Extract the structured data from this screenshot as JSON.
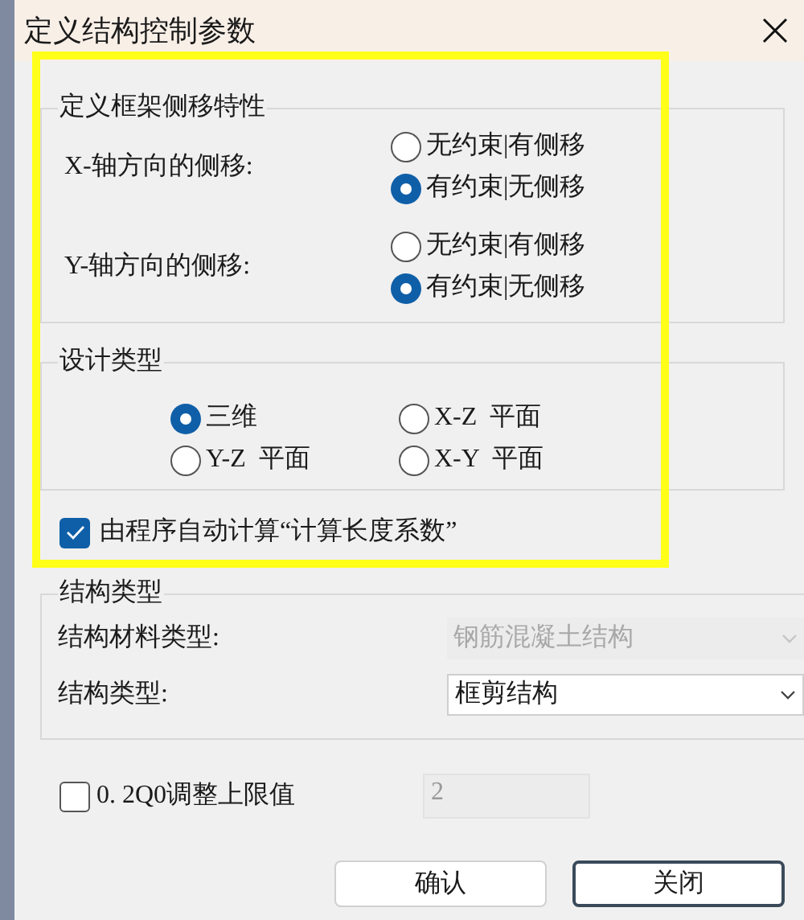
{
  "window": {
    "title": "定义结构控制参数"
  },
  "sway": {
    "title": "定义框架侧移特性",
    "axes": [
      {
        "label": "X-轴方向的侧移:",
        "options": [
          {
            "label": "无约束|有侧移",
            "selected": false
          },
          {
            "label": "有约束|无侧移",
            "selected": true
          }
        ]
      },
      {
        "label": "Y-轴方向的侧移:",
        "options": [
          {
            "label": "无约束|有侧移",
            "selected": false
          },
          {
            "label": "有约束|无侧移",
            "selected": true
          }
        ]
      }
    ]
  },
  "design_type": {
    "title": "设计类型",
    "options": [
      {
        "label": "三维",
        "selected": true
      },
      {
        "label": "X-Z  平面",
        "selected": false
      },
      {
        "label": "Y-Z  平面",
        "selected": false
      },
      {
        "label": "X-Y  平面",
        "selected": false
      }
    ]
  },
  "auto_calc": {
    "label": "由程序自动计算“计算长度系数”",
    "checked": true
  },
  "structure": {
    "title": "结构类型",
    "fields": [
      {
        "label": "结构材料类型:",
        "value": "钢筋混凝土结构",
        "disabled": true
      },
      {
        "label": "结构类型:",
        "value": "框剪结构",
        "disabled": false
      }
    ]
  },
  "limit": {
    "label": "0. 2Q0调整上限值",
    "checked": false,
    "value": "2",
    "disabled": true
  },
  "buttons": [
    {
      "label": "确认",
      "focused": false
    },
    {
      "label": "关闭",
      "focused": true
    }
  ]
}
